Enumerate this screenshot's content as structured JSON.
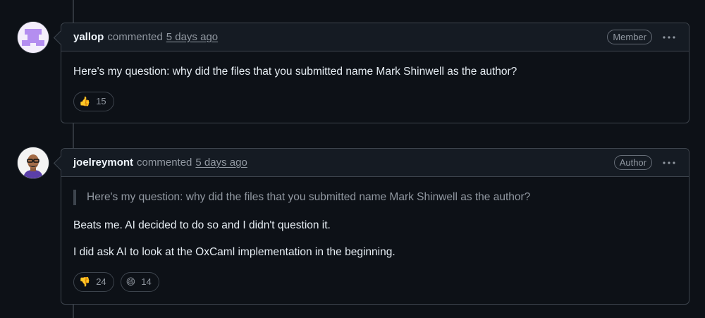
{
  "comments": [
    {
      "author": "yallop",
      "action": "commented",
      "time": "5 days ago",
      "badge": "Member",
      "avatar_icon": "identicon-avatar",
      "quote": "",
      "paragraphs": [
        "Here's my question: why did the files that you submitted name Mark Shinwell as the author?"
      ],
      "reactions": [
        {
          "emoji": "👍",
          "icon": "thumbs-up-icon",
          "count": "15"
        }
      ]
    },
    {
      "author": "joelreymont",
      "action": "commented",
      "time": "5 days ago",
      "badge": "Author",
      "avatar_icon": "user-photo-avatar",
      "quote": "Here's my question: why did the files that you submitted name Mark Shinwell as the author?",
      "paragraphs": [
        "Beats me. AI decided to do so and I didn't question it.",
        "I did ask AI to look at the OxCaml implementation in the beginning."
      ],
      "reactions": [
        {
          "emoji": "👎",
          "icon": "thumbs-down-icon",
          "count": "24"
        },
        {
          "emoji": "😄",
          "icon": "laugh-icon",
          "count": "14"
        }
      ]
    }
  ],
  "colors": {
    "background": "#0d1117",
    "header_bg": "#151b23",
    "border": "#3d444d",
    "muted_text": "#9198a1",
    "primary_text": "#f0f6fc",
    "identicon": "#b48ef0"
  }
}
